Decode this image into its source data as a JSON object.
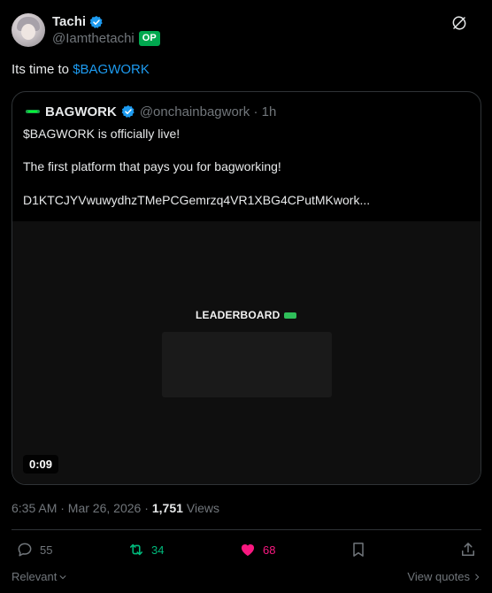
{
  "author": {
    "name": "Tachi",
    "handle": "@Iamthetachi",
    "badge": "OP"
  },
  "tweet": {
    "text_prefix": "Its time to ",
    "cashtag": "$BAGWORK"
  },
  "quote": {
    "name": "BAGWORK",
    "handle_time": "@onchainbagwork · 1h",
    "line1": "$BAGWORK is officially live!",
    "line2": "The first platform that pays you for bagworking!",
    "line3": "D1KTCJYVwuwydhzTMePCGemrzq4VR1XBG4CPutMKwork...",
    "media": {
      "title": "LEADERBOARD",
      "duration": "0:09"
    }
  },
  "meta": {
    "timestamp": "6:35 AM · Mar 26, 2026 ·",
    "views_count": "1,751",
    "views_label": "Views"
  },
  "actions": {
    "replies": "55",
    "reposts": "34",
    "likes": "68"
  },
  "footer": {
    "sort_label": "Relevant",
    "view_quotes": "View quotes"
  },
  "colors": {
    "background": "#000000",
    "link": "#1d9bf0",
    "muted": "#71767b",
    "repost_active": "#00ba7c",
    "like_active": "#f91880",
    "op_badge": "#00a84f",
    "border": "#2f3336"
  },
  "icons": {
    "verified": "verified-badge-icon",
    "grok": "grok-icon",
    "reply": "reply-icon",
    "repost": "repost-icon",
    "like": "heart-icon",
    "bookmark": "bookmark-icon",
    "share": "share-icon"
  }
}
